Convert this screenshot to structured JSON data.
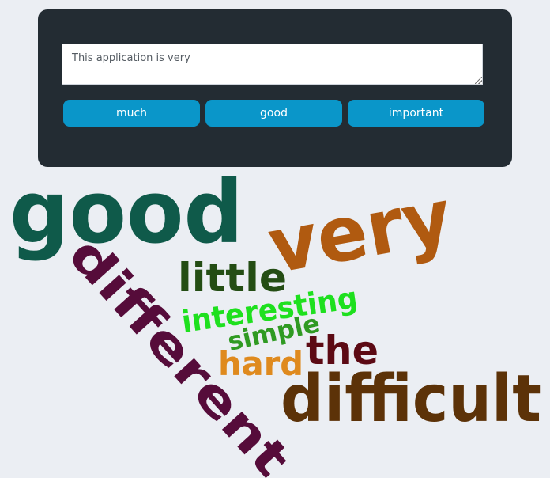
{
  "input": {
    "value": "This application is very",
    "placeholder": ""
  },
  "suggestions": [
    {
      "label": "much"
    },
    {
      "label": "good"
    },
    {
      "label": "important"
    }
  ],
  "word_cloud": {
    "words": [
      {
        "text": "good",
        "color": "#0f5a4a"
      },
      {
        "text": "very",
        "color": "#b05a10"
      },
      {
        "text": "different",
        "color": "#560c3a"
      },
      {
        "text": "little",
        "color": "#244d14"
      },
      {
        "text": "interesting",
        "color": "#1ee01e"
      },
      {
        "text": "simple",
        "color": "#2f9a22"
      },
      {
        "text": "the",
        "color": "#5c0a14"
      },
      {
        "text": "hard",
        "color": "#df8a1e"
      },
      {
        "text": "difficult",
        "color": "#5c3208"
      }
    ]
  },
  "colors": {
    "background": "#ebeef3",
    "panel": "#232c33",
    "button": "#0a96c9",
    "button_text": "#ffffff"
  }
}
